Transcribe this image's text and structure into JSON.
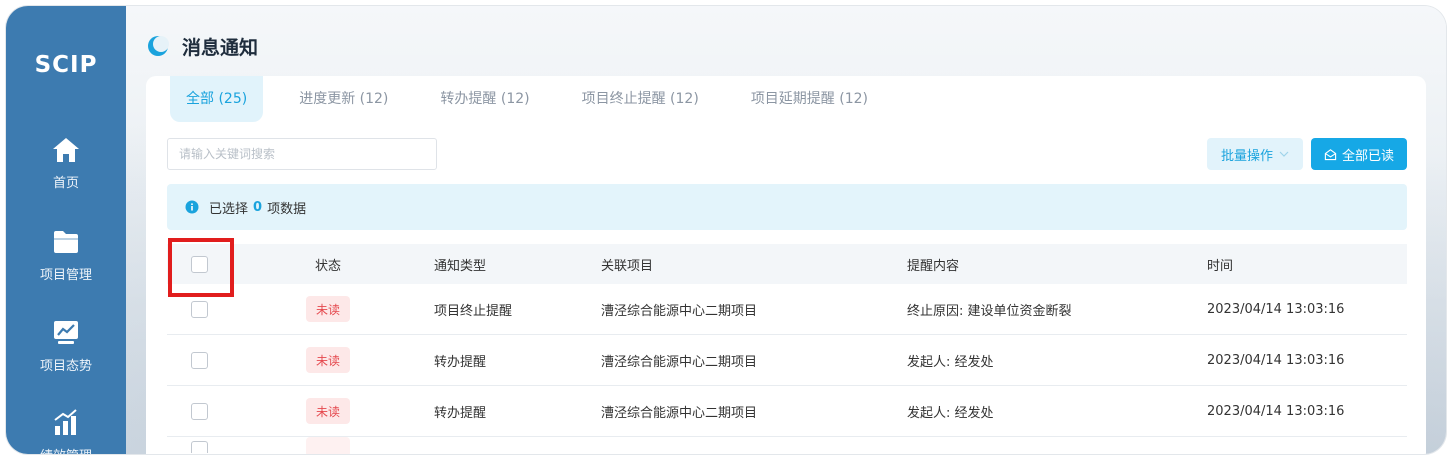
{
  "app": {
    "logo": "SCIP"
  },
  "sidebar": {
    "items": [
      {
        "label": "首页",
        "icon": "home-icon"
      },
      {
        "label": "项目管理",
        "icon": "folder-icon"
      },
      {
        "label": "项目态势",
        "icon": "trend-board-icon"
      },
      {
        "label": "绩效管理",
        "icon": "bar-chart-icon"
      }
    ]
  },
  "header": {
    "title": "消息通知"
  },
  "tabs": [
    {
      "label": "全部 (25)",
      "active": true
    },
    {
      "label": "进度更新 (12)",
      "active": false
    },
    {
      "label": "转办提醒 (12)",
      "active": false
    },
    {
      "label": "项目终止提醒 (12)",
      "active": false
    },
    {
      "label": "项目延期提醒 (12)",
      "active": false
    }
  ],
  "search": {
    "placeholder": "请输入关键词搜索",
    "value": ""
  },
  "toolbar": {
    "bulk_label": "批量操作",
    "read_all_label": "全部已读"
  },
  "alert": {
    "prefix": "已选择",
    "count": "0",
    "suffix": "项数据"
  },
  "table": {
    "columns": [
      "状态",
      "通知类型",
      "关联项目",
      "提醒内容",
      "时间"
    ],
    "rows": [
      {
        "status": "未读",
        "type": "项目终止提醒",
        "project": "漕泾综合能源中心二期项目",
        "content": "终止原因: 建设单位资金断裂",
        "time": "2023/04/14 13:03:16"
      },
      {
        "status": "未读",
        "type": "转办提醒",
        "project": "漕泾综合能源中心二期项目",
        "content": "发起人: 经发处",
        "time": "2023/04/14 13:03:16"
      },
      {
        "status": "未读",
        "type": "转办提醒",
        "project": "漕泾综合能源中心二期项目",
        "content": "发起人: 经发处",
        "time": "2023/04/14 13:03:16"
      }
    ]
  },
  "colors": {
    "sidebar_bg": "#3d7bb0",
    "accent": "#16a8e6",
    "unread_badge_bg": "#fde8e8",
    "unread_badge_text": "#e5484d",
    "highlight": "#e11d1d"
  }
}
